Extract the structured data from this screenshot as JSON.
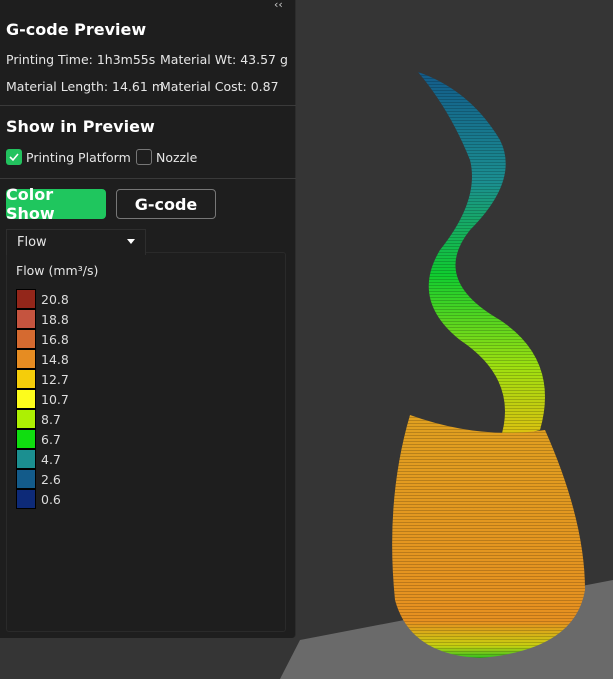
{
  "panel": {
    "collapse_icon": "double-chevron-left",
    "title": "G-code Preview",
    "stats": {
      "printing_time": "Printing Time: 1h3m55s",
      "material_wt": "Material Wt: 43.57 g",
      "material_length": "Material Length: 14.61 m",
      "material_cost": "Material Cost: 0.87"
    },
    "show_title": "Show in Preview",
    "printing_platform": {
      "label": "Printing Platform",
      "checked": true
    },
    "nozzle": {
      "label": "Nozzle",
      "checked": false
    },
    "color_show": "Color Show",
    "gcode": "G-code",
    "dropdown": "Flow",
    "legend_title": "Flow (mm³/s)",
    "legend": [
      {
        "value": "20.8",
        "color": "#93261a"
      },
      {
        "value": "18.8",
        "color": "#c5543f"
      },
      {
        "value": "16.8",
        "color": "#d56a30"
      },
      {
        "value": "14.8",
        "color": "#e68c22"
      },
      {
        "value": "12.7",
        "color": "#f5cd0a"
      },
      {
        "value": "10.7",
        "color": "#fdfc1c"
      },
      {
        "value": "8.7",
        "color": "#adf003"
      },
      {
        "value": "6.7",
        "color": "#10dd10"
      },
      {
        "value": "4.7",
        "color": "#1b8f90"
      },
      {
        "value": "2.6",
        "color": "#135b8a"
      },
      {
        "value": "0.6",
        "color": "#0d2a78"
      }
    ]
  }
}
